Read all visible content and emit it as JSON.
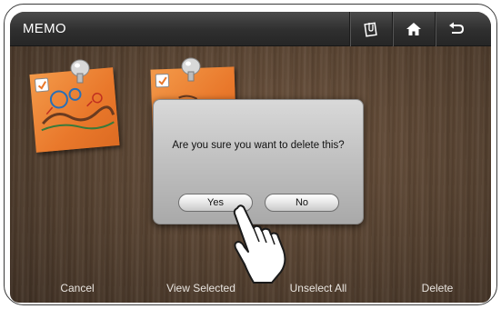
{
  "app": {
    "title": "MEMO"
  },
  "header_icons": [
    "memo-clip-icon",
    "home-icon",
    "back-icon"
  ],
  "dialog": {
    "message": "Are you sure you want to delete this?",
    "yes_label": "Yes",
    "no_label": "No"
  },
  "notes": [
    {
      "checked": true
    },
    {
      "checked": true
    }
  ],
  "bottom_bar": {
    "cancel": "Cancel",
    "view_selected": "View Selected",
    "unselect_all": "Unselect All",
    "delete": "Delete"
  },
  "colors": {
    "note_orange": "#e9782b",
    "title_bar": "#2f2f2f",
    "wood": "#54402f"
  }
}
